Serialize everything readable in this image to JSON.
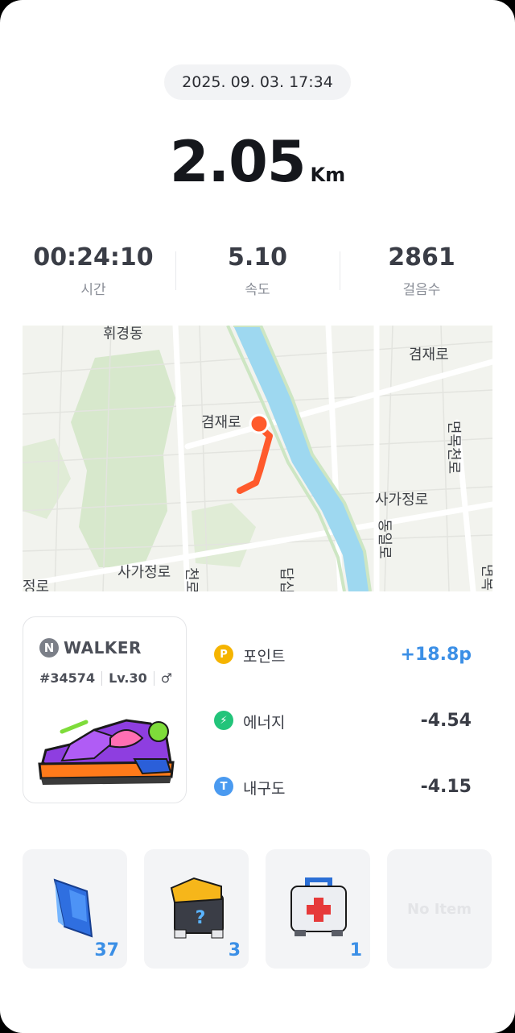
{
  "header": {
    "datetime": "2025. 09. 03. 17:34"
  },
  "distance": {
    "value": "2.05",
    "unit": "Km"
  },
  "stats": [
    {
      "value": "00:24:10",
      "label": "시간"
    },
    {
      "value": "5.10",
      "label": "속도"
    },
    {
      "value": "2861",
      "label": "걸음수"
    }
  ],
  "map": {
    "labels": {
      "top_left": "휘경동",
      "top_right": "겸재로",
      "center": "겸재로",
      "right_vertical": "면목천로",
      "mid_right": "사가정로",
      "bottom_center": "사가정로",
      "bottom_left": "정로",
      "bottom_vertical_1": "동일로",
      "bottom_vertical_2": "천로",
      "bottom_vertical_3": "답십",
      "edge_right": "면목"
    },
    "route_color": "#ff5a2c"
  },
  "nft": {
    "brand_letter": "N",
    "brand_name": "WALKER",
    "id": "#34574",
    "level": "Lv.30",
    "gender_symbol": "♂"
  },
  "rewards": [
    {
      "icon": "point-icon",
      "glyph": "P",
      "color": "#f5b400",
      "name": "포인트",
      "value": "+18.8p",
      "value_color": "#3b8fe6"
    },
    {
      "icon": "energy-icon",
      "glyph": "⚡",
      "color": "#22c47a",
      "name": "에너지",
      "value": "-4.54",
      "value_color": "#3a3d46"
    },
    {
      "icon": "durability-icon",
      "glyph": "T",
      "color": "#4a9af0",
      "name": "내구도",
      "value": "-4.15",
      "value_color": "#3a3d46"
    }
  ],
  "items": [
    {
      "icon": "crystal-icon",
      "count": "37"
    },
    {
      "icon": "mystery-box-icon",
      "count": "3"
    },
    {
      "icon": "first-aid-kit-icon",
      "count": "1"
    },
    {
      "icon": "",
      "empty_label": "No Item"
    }
  ]
}
